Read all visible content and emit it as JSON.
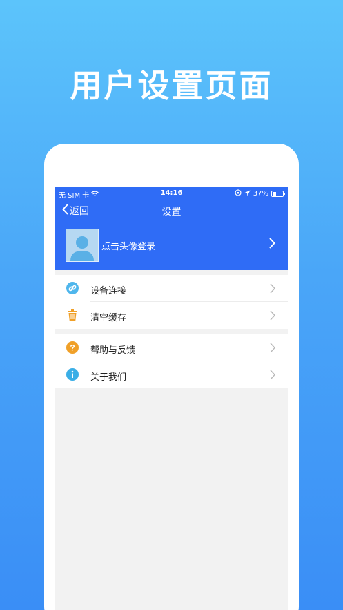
{
  "promo": {
    "title": "用户设置页面"
  },
  "status_bar": {
    "carrier": "无 SIM 卡",
    "time": "14:16",
    "battery_text": "37%",
    "battery_level": 0.37
  },
  "nav": {
    "back_label": "返回",
    "title": "设置"
  },
  "profile": {
    "login_text": "点击头像登录"
  },
  "menu_groups": [
    [
      {
        "label": "设备连接",
        "icon": "link-icon",
        "color": "#4fb6ec"
      },
      {
        "label": "清空缓存",
        "icon": "trash-icon",
        "color": "#f0a028"
      }
    ],
    [
      {
        "label": "帮助与反馈",
        "icon": "question-icon",
        "color": "#f0a028"
      },
      {
        "label": "关于我们",
        "icon": "info-icon",
        "color": "#3aaee6"
      }
    ]
  ],
  "colors": {
    "header": "#2f6cf6",
    "background": "#f2f2f2"
  }
}
